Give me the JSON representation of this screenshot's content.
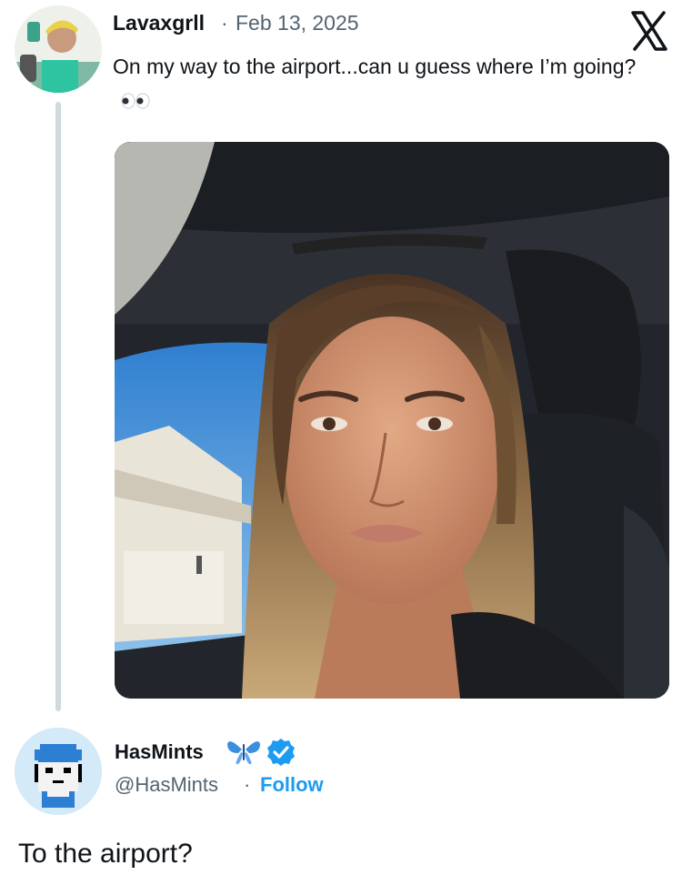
{
  "tweet": {
    "author": "Lavaxgrll",
    "separator": "·",
    "date": "Feb 13, 2025",
    "text": "On my way to the airport...can u guess where I’m going?",
    "emoji_icon": "eyes-emoji-icon",
    "platform_icon": "x-logo-icon"
  },
  "reply": {
    "author": "HasMints",
    "handle": "@HasMints",
    "separator": "·",
    "follow_label": "Follow",
    "text": "To the airport?",
    "badge_icon": "verified-badge-icon",
    "emoji_icon": "blue-butterfly-icon"
  },
  "colors": {
    "link_blue": "#1d9bf0",
    "muted": "#536471",
    "thread_line": "#cfd9de",
    "text": "#0f1419"
  }
}
